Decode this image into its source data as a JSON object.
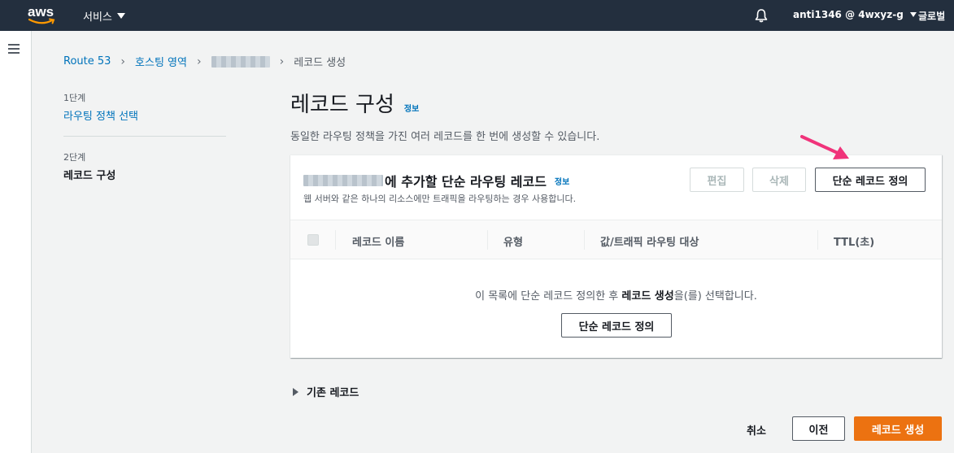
{
  "nav": {
    "logo_text": "aws",
    "services_label": "서비스",
    "account_label": "anti1346 @ 4wxyz-g",
    "region_label": "글로벌"
  },
  "breadcrumb": {
    "items": [
      "Route 53",
      "호스팅 영역"
    ],
    "current": "레코드 생성"
  },
  "steps": {
    "step1_label": "1단계",
    "step1_link": "라우팅 정책 선택",
    "step2_label": "2단계",
    "step2_title": "레코드 구성"
  },
  "main": {
    "title": "레코드 구성",
    "info": "정보",
    "description": "동일한 라우팅 정책을 가진 여러 레코드를 한 번에 생성할 수 있습니다."
  },
  "panel": {
    "title_suffix": "에 추가할 단순 라우팅 레코드",
    "info": "정보",
    "subtitle": "웹 서버와 같은 하나의 리소스에만 트래픽을 라우팅하는 경우 사용합니다.",
    "edit_button": "편집",
    "delete_button": "삭제",
    "define_button": "단순 레코드 정의",
    "columns": [
      "레코드 이름",
      "유형",
      "값/트래픽 라우팅 대상",
      "TTL(초)"
    ],
    "empty_prefix": "이 목록에 단순 레코드 정의한 후 ",
    "empty_bold": "레코드 생성",
    "empty_suffix": "을(를) 선택합니다.",
    "empty_define_button": "단순 레코드 정의"
  },
  "existing_records": "기존 레코드",
  "footer": {
    "cancel": "취소",
    "previous": "이전",
    "create": "레코드 생성"
  },
  "colors": {
    "nav_bg": "#232f3e",
    "link": "#0073bb",
    "primary": "#ec7211",
    "annotation_arrow": "#f0337a"
  }
}
